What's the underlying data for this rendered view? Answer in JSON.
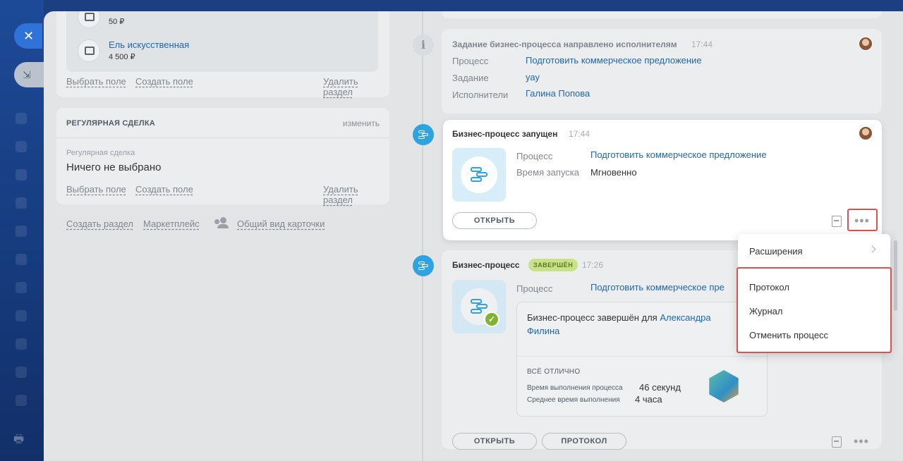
{
  "products": [
    {
      "name": "",
      "price": "50 ₽"
    },
    {
      "name": "Ель искусственная",
      "price": "4 500 ₽"
    }
  ],
  "section1_links": {
    "choose": "Выбрать поле",
    "create": "Создать поле",
    "delete": "Удалить раздел"
  },
  "section2": {
    "title": "РЕГУЛЯРНАЯ СДЕЛКА",
    "edit": "изменить",
    "field_label": "Регулярная сделка",
    "field_value": "Ничего не выбрано",
    "choose": "Выбрать поле",
    "create": "Создать поле",
    "delete": "Удалить раздел"
  },
  "footer_links": {
    "create_section": "Создать раздел",
    "marketplace": "Маркетплейс",
    "common_view": "Общий вид карточки"
  },
  "task_card": {
    "title": "Задание бизнес-процесса направлено исполнителям",
    "time": "17:44",
    "process_label": "Процесс",
    "process_value": "Подготовить коммерческое предложение",
    "task_label": "Задание",
    "task_value": "уау",
    "exec_label": "Исполнители",
    "exec_value": "Галина Попова"
  },
  "started_card": {
    "title": "Бизнес-процесс запущен",
    "time": "17:44",
    "process_label": "Процесс",
    "process_value": "Подготовить коммерческое предложение",
    "start_label": "Время запуска",
    "start_value": "Мгновенно",
    "open_button": "ОТКРЫТЬ",
    "more_icon": "•••"
  },
  "finished_card": {
    "title": "Бизнес-процесс",
    "badge": "ЗАВЕРШЁН",
    "time": "17:26",
    "process_label": "Процесс",
    "process_value": "Подготовить коммерческое пре",
    "result_text": "Бизнес-процесс завершён для",
    "result_user_1": "Александра",
    "result_user_2": "Филина",
    "rating": "ВСЁ ОТЛИЧНО",
    "duration_label": "Время выполнения процесса",
    "duration_value": "46 секунд",
    "avg_label": "Среднее время выполнения",
    "avg_value": "4 часа",
    "open_button": "ОТКРЫТЬ",
    "protocol_button": "ПРОТОКОЛ",
    "more_icon": "•••"
  },
  "menu": {
    "extensions": "Расширения",
    "protocol": "Протокол",
    "journal": "Журнал",
    "cancel": "Отменить процесс"
  },
  "icons": {
    "close": "✕",
    "collapse": "⇲",
    "print": "🖶",
    "info": "i",
    "check": "✓"
  },
  "colors": {
    "accent_blue": "#2fa2e0",
    "link": "#2067b0",
    "highlight_red": "#d9534f",
    "badge_green": "#c9e28a"
  }
}
